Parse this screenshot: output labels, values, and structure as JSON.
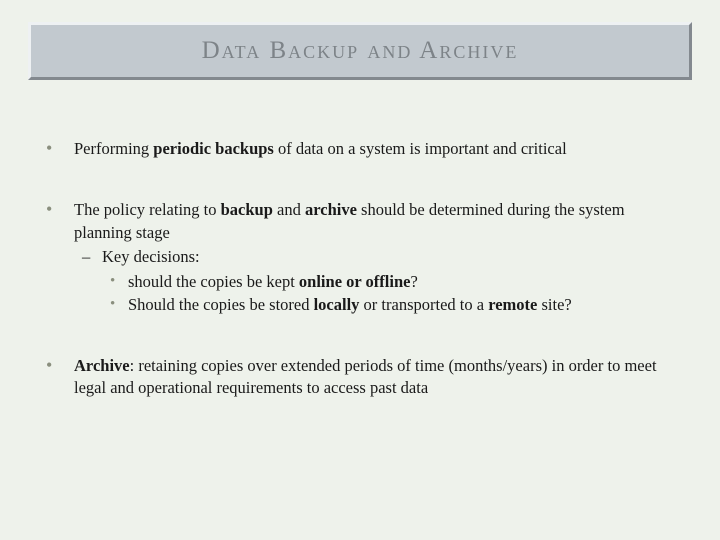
{
  "title": "Data Backup and Archive",
  "bullets": [
    {
      "html": "Performing <b>periodic backups</b> of data on a system is important and critical"
    },
    {
      "html": "The policy relating to <b>backup</b> and <b>archive</b> should be determined during the system planning stage",
      "sub": [
        {
          "html": "Key decisions:",
          "sub2": [
            {
              "html": "should the copies be kept <b>online or offline</b>?"
            },
            {
              "html": "Should the copies be stored <b>locally</b> or transported to a <b>remote</b> site?"
            }
          ]
        }
      ]
    },
    {
      "html": "<b>Archive</b>: retaining copies over extended periods of time (months/years) in order to meet legal and operational requirements to access past data"
    }
  ]
}
